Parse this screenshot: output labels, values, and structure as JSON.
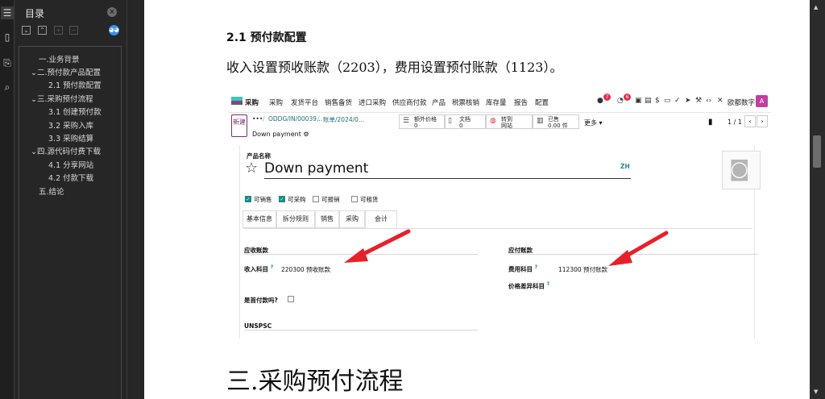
{
  "toc": {
    "title": "目录",
    "items": [
      "一.业务背景",
      "二.预付款产品配置",
      "2.1 预付款配置",
      "三.采购预付流程",
      "3.1 创建预付款",
      "3.2 采购入库",
      "3.3 采购结算",
      "四.源代码付费下载",
      "4.1 分享网站",
      "4.2 付款下载",
      "五.结论"
    ]
  },
  "doc": {
    "section_heading": "2.1 预付款配置",
    "paragraph": "收入设置预收账款（2203），费用设置预付账款（1123）。",
    "next_heading": "三.采购预付流程"
  },
  "odoo": {
    "menu": [
      "采购",
      "采购",
      "发货平台",
      "销售备货",
      "进口采购",
      "供应商付款",
      "产品",
      "税票核销",
      "库存量",
      "报告",
      "配置"
    ],
    "company": "欧都数字",
    "avatar": "A",
    "chat_badge": "7",
    "activity_badge": "6",
    "new_label": "新建",
    "breadcrumb": [
      "•••",
      "/",
      "ODDG/IN/00039...",
      "/",
      "账单/2024/0..."
    ],
    "record_name": "Down payment",
    "stats": [
      {
        "label": "额外价格",
        "value": "0",
        "icon": "list-icon"
      },
      {
        "label": "文档",
        "value": "0",
        "icon": "file-icon"
      },
      {
        "label": "转到",
        "value": "网站",
        "icon": "globe-icon"
      },
      {
        "label": "已售",
        "value": "0.00 件",
        "icon": "chart-icon"
      }
    ],
    "more_label": "更多",
    "pager": "1 / 1",
    "product_label": "产品名称",
    "product_name": "Down payment",
    "lang": "ZH",
    "flags": [
      {
        "label": "可销售",
        "checked": true
      },
      {
        "label": "可采购",
        "checked": true
      },
      {
        "label": "可报销",
        "checked": false
      },
      {
        "label": "可租赁",
        "checked": false
      }
    ],
    "tabs": [
      "基本信息",
      "拆分规则",
      "销售",
      "采购",
      "会计"
    ],
    "receivable_title": "应收账款",
    "income_label": "收入科目",
    "income_value": "220300 预收账款",
    "payable_title": "应付账款",
    "expense_label": "费用科目",
    "expense_value": "112300 预付账款",
    "price_diff_label": "价格差异科目",
    "down_payment_label": "是首付款吗?",
    "unspsc_title": "UNSPSC"
  },
  "colors": {
    "arrow": "#e8202a",
    "teal": "#1a8a8a",
    "brand": "#7b2f6b"
  }
}
